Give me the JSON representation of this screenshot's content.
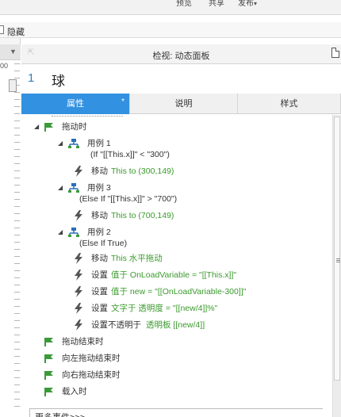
{
  "topbar": {
    "preview_label": "预览",
    "share_label": "共享",
    "publish_label": "发布",
    "publish_caret": "▾"
  },
  "hide_row": {
    "label": "隐藏"
  },
  "left_strip": {
    "ruler_number": "00"
  },
  "inspector": {
    "title": "检视: 动态面板",
    "widget_index": "1",
    "widget_name": "球",
    "tabs": [
      {
        "label": "属性",
        "marker": "*"
      },
      {
        "label": "说明"
      },
      {
        "label": "样式"
      }
    ]
  },
  "events": {
    "drag": {
      "label": "拖动时",
      "cases": [
        {
          "label": "用例 1",
          "condition": "(If \"[[This.x]]\" < \"300\")",
          "actions": [
            {
              "verb": "移动",
              "rest": "This to (300,149)"
            }
          ]
        },
        {
          "label": "用例 3",
          "condition": "(Else If \"[[This.x]]\" > \"700\")",
          "actions": [
            {
              "verb": "移动",
              "rest": "This to (700,149)"
            }
          ]
        },
        {
          "label": "用例 2",
          "condition": "(Else If True)",
          "actions": [
            {
              "verb": "移动",
              "rest": "This 水平拖动"
            },
            {
              "verb": "设置",
              "rest": "值于 OnLoadVariable = \"[[This.x]]\""
            },
            {
              "verb": "设置",
              "rest": "值于 new = \"[[OnLoadVariable-300]]\""
            },
            {
              "verb": "设置",
              "rest": "文字于 透明度 = \"[[new/4]]%\""
            },
            {
              "verb": "设置不透明于",
              "rest": "透明板 [[new/4]]"
            }
          ]
        }
      ]
    },
    "others": [
      {
        "label": "拖动结束时"
      },
      {
        "label": "向左拖动结束时"
      },
      {
        "label": "向右拖动结束时"
      },
      {
        "label": "载入时"
      }
    ]
  },
  "more_events": {
    "label": "更多事件>>>"
  },
  "colors": {
    "accent_blue": "#3291e0",
    "action_green": "#3a9a2c",
    "event_icon_green": "#3b9a3a",
    "case_icon_blue": "#2b6fb6"
  }
}
